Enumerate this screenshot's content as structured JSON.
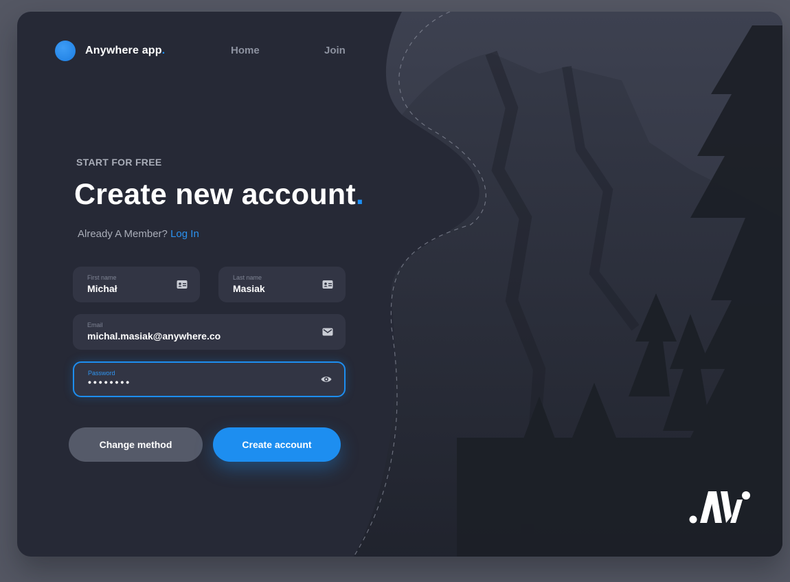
{
  "nav": {
    "brand": "Anywhere app",
    "brand_dot": ".",
    "links": [
      "Home",
      "Join"
    ]
  },
  "hero": {
    "eyebrow": "START FOR FREE",
    "title": "Create new account",
    "title_dot": ".",
    "member_text": "Already A Member?",
    "login_link": "Log In"
  },
  "form": {
    "first_name": {
      "label": "First name",
      "value": "Michał",
      "icon": "contact-card-icon"
    },
    "last_name": {
      "label": "Last name",
      "value": "Masiak",
      "icon": "contact-card-icon"
    },
    "email": {
      "label": "Email",
      "value": "michal.masiak@anywhere.co",
      "icon": "mail-icon"
    },
    "password": {
      "label": "Password",
      "value": "••••••••",
      "icon": "eye-icon"
    }
  },
  "buttons": {
    "change_method": "Change method",
    "create_account": "Create account"
  },
  "colors": {
    "accent": "#1d8ef0",
    "card_bg": "#262936",
    "field_bg": "#323544",
    "page_bg": "#545763"
  }
}
